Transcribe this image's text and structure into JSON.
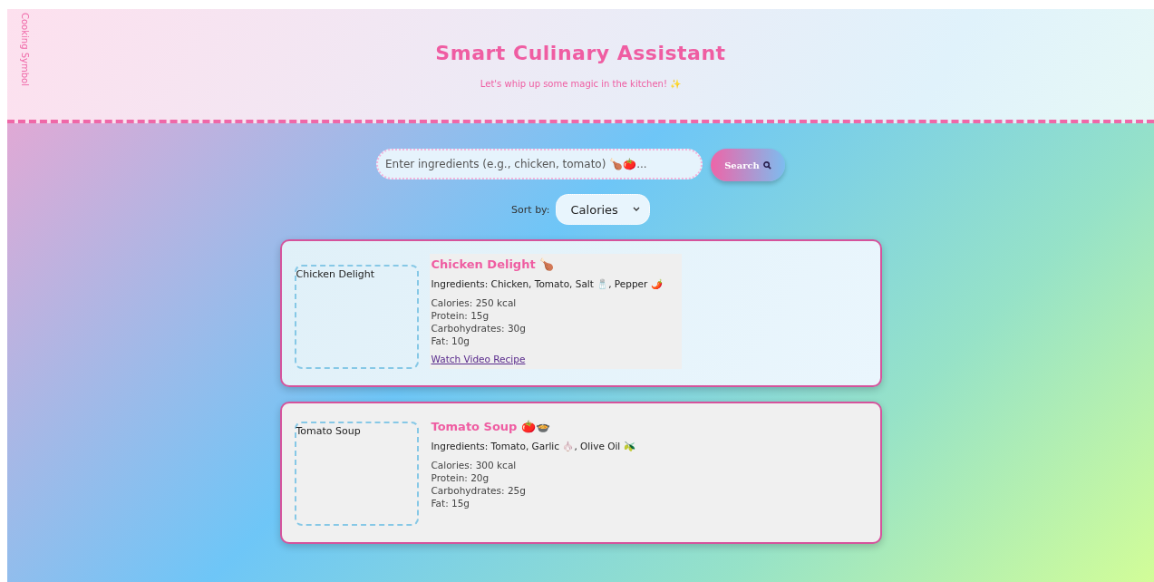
{
  "header": {
    "logo_alt": "Cooking Symbol",
    "title": "Smart Culinary Assistant",
    "tagline": "Let's whip up some magic in the kitchen! ✨"
  },
  "search": {
    "placeholder": "Enter ingredients (e.g., chicken, tomato) 🍗🍅...",
    "button": "Search"
  },
  "sort": {
    "label": "Sort by:",
    "value": "Calories"
  },
  "recipes": [
    {
      "image_alt": "Chicken Delight",
      "title": "Chicken Delight 🍗",
      "highlighted": true,
      "ingredients": "Ingredients: Chicken, Tomato, Salt 🧂, Pepper 🌶️",
      "nutrition": [
        "Calories: 250 kcal",
        "Protein: 15g",
        "Carbohydrates: 30g",
        "Fat: 10g"
      ],
      "video_link": "Watch Video Recipe"
    },
    {
      "image_alt": "Tomato Soup",
      "title": "Tomato Soup 🍅🍲",
      "highlighted": false,
      "ingredients": "Ingredients: Tomato, Garlic 🧄, Olive Oil 🫒",
      "nutrition": [
        "Calories: 300 kcal",
        "Protein: 20g",
        "Carbohydrates: 25g",
        "Fat: 15g"
      ]
    }
  ]
}
